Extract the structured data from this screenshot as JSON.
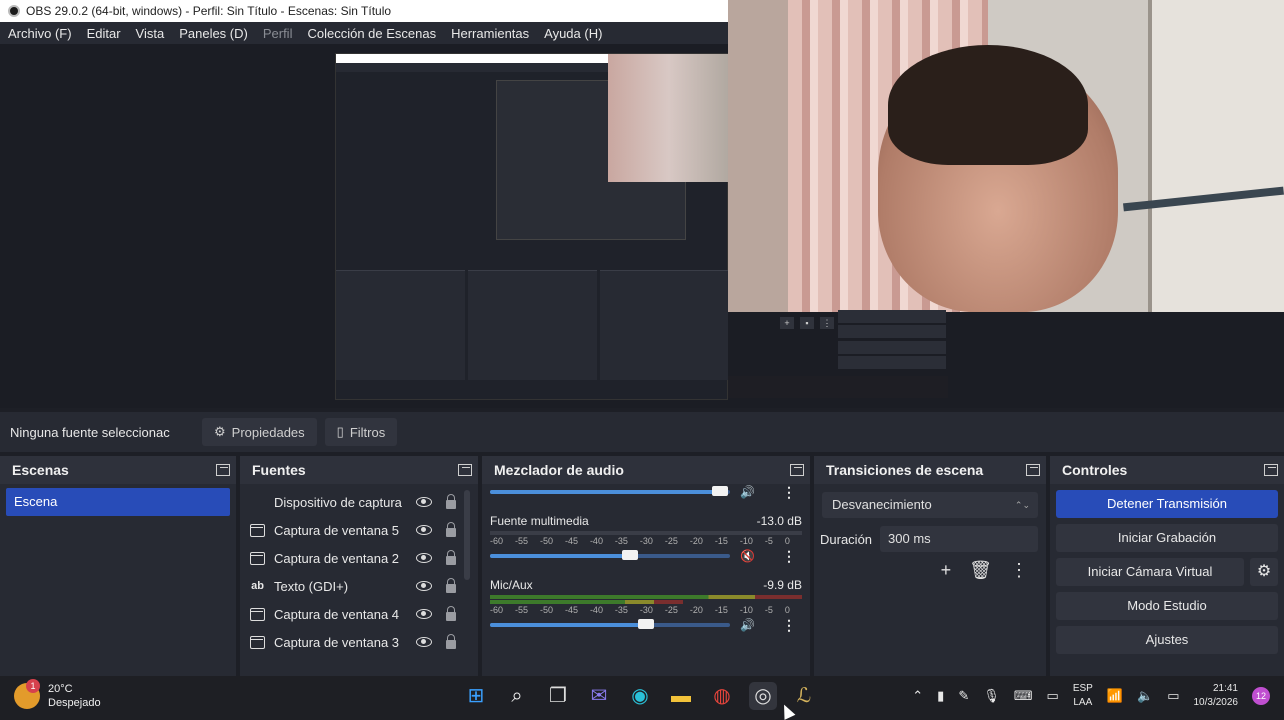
{
  "window": {
    "title": "OBS 29.0.2 (64-bit, windows) - Perfil: Sin Título - Escenas: Sin Título"
  },
  "menu": [
    "Archivo (F)",
    "Editar",
    "Vista",
    "Paneles (D)",
    "Perfil",
    "Colección de Escenas",
    "Herramientas",
    "Ayuda (H)"
  ],
  "toolbar": {
    "no_source": "Ninguna fuente seleccionac",
    "properties": "Propiedades",
    "filters": "Filtros"
  },
  "scenes": {
    "title": "Escenas",
    "items": [
      "Escena"
    ]
  },
  "sources": {
    "title": "Fuentes",
    "items": [
      {
        "label": "Dispositivo de captura",
        "icon": "camera-icon"
      },
      {
        "label": "Captura de ventana 5",
        "icon": "window-icon"
      },
      {
        "label": "Captura de ventana 2",
        "icon": "window-icon"
      },
      {
        "label": "Texto (GDI+)",
        "icon": "text-icon"
      },
      {
        "label": "Captura de ventana 4",
        "icon": "window-icon"
      },
      {
        "label": "Captura de ventana 3",
        "icon": "window-icon"
      }
    ]
  },
  "mixer": {
    "title": "Mezclador de audio",
    "ticks": [
      "-60",
      "-55",
      "-50",
      "-45",
      "-40",
      "-35",
      "-30",
      "-25",
      "-20",
      "-15",
      "-10",
      "-5",
      "0"
    ],
    "channels": [
      {
        "name": "Fuente multimedia",
        "db": "-13.0 dB",
        "level": 0.58,
        "muted": true
      },
      {
        "name": "Mic/Aux",
        "db": "-9.9 dB",
        "level": 0.65,
        "muted": false
      }
    ]
  },
  "transitions": {
    "title": "Transiciones de escena",
    "selected": "Desvanecimiento",
    "duration_label": "Duración",
    "duration_value": "300 ms"
  },
  "controls": {
    "title": "Controles",
    "stop_stream": "Detener Transmisión",
    "start_record": "Iniciar Grabación",
    "virtual_cam": "Iniciar Cámara Virtual",
    "studio_mode": "Modo Estudio",
    "settings": "Ajustes"
  },
  "taskbar": {
    "temp": "20°C",
    "weather": "Despejado",
    "weather_badge": "1",
    "lang1": "ESP",
    "lang2": "LAA",
    "time": "21:41",
    "date": "10/3/2026",
    "notifications": "12"
  },
  "colors": {
    "accent": "#284cb8",
    "panel": "#272a33",
    "bg": "#1d1f26"
  }
}
